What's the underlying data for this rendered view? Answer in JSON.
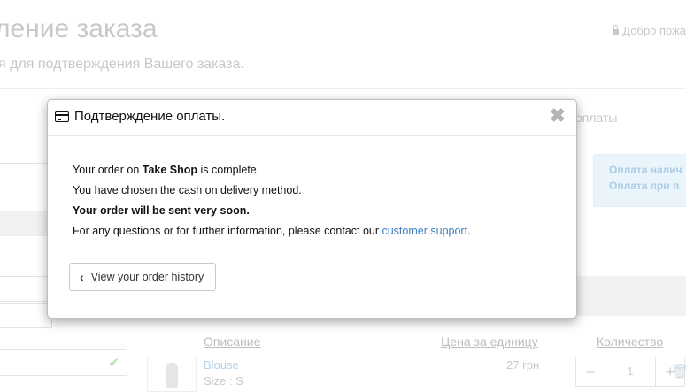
{
  "background": {
    "page_title": "ление заказа",
    "page_subtitle": "я для подтверждения Вашего заказа.",
    "welcome": "Добро пожа",
    "step_label": "оплаты",
    "payinfo_line1": "Оплата налич",
    "payinfo_line2": "Оплата при п",
    "columns": {
      "description": "Описание",
      "unit_price": "Цена за единицу",
      "quantity": "Количество"
    },
    "product": {
      "name": "Blouse",
      "size": "Size : S",
      "price": "27 грн",
      "qty": "1"
    },
    "stepper_minus": "−",
    "stepper_plus": "+"
  },
  "modal": {
    "title": "Подтверждение оплаты.",
    "close_symbol": "✖",
    "line1_prefix": "Your order on ",
    "shop_name": "Take Shop",
    "line1_suffix": " is complete.",
    "line2": "You have chosen the cash on delivery method.",
    "line3": "Your order will be sent very soon.",
    "line4_prefix": "For any questions or for further information, please contact our ",
    "support_link": "customer support",
    "line4_suffix": ".",
    "history_button": "View your order history"
  },
  "colors": {
    "link": "#3d7fbf",
    "muted_text": "#c8c8c8"
  }
}
